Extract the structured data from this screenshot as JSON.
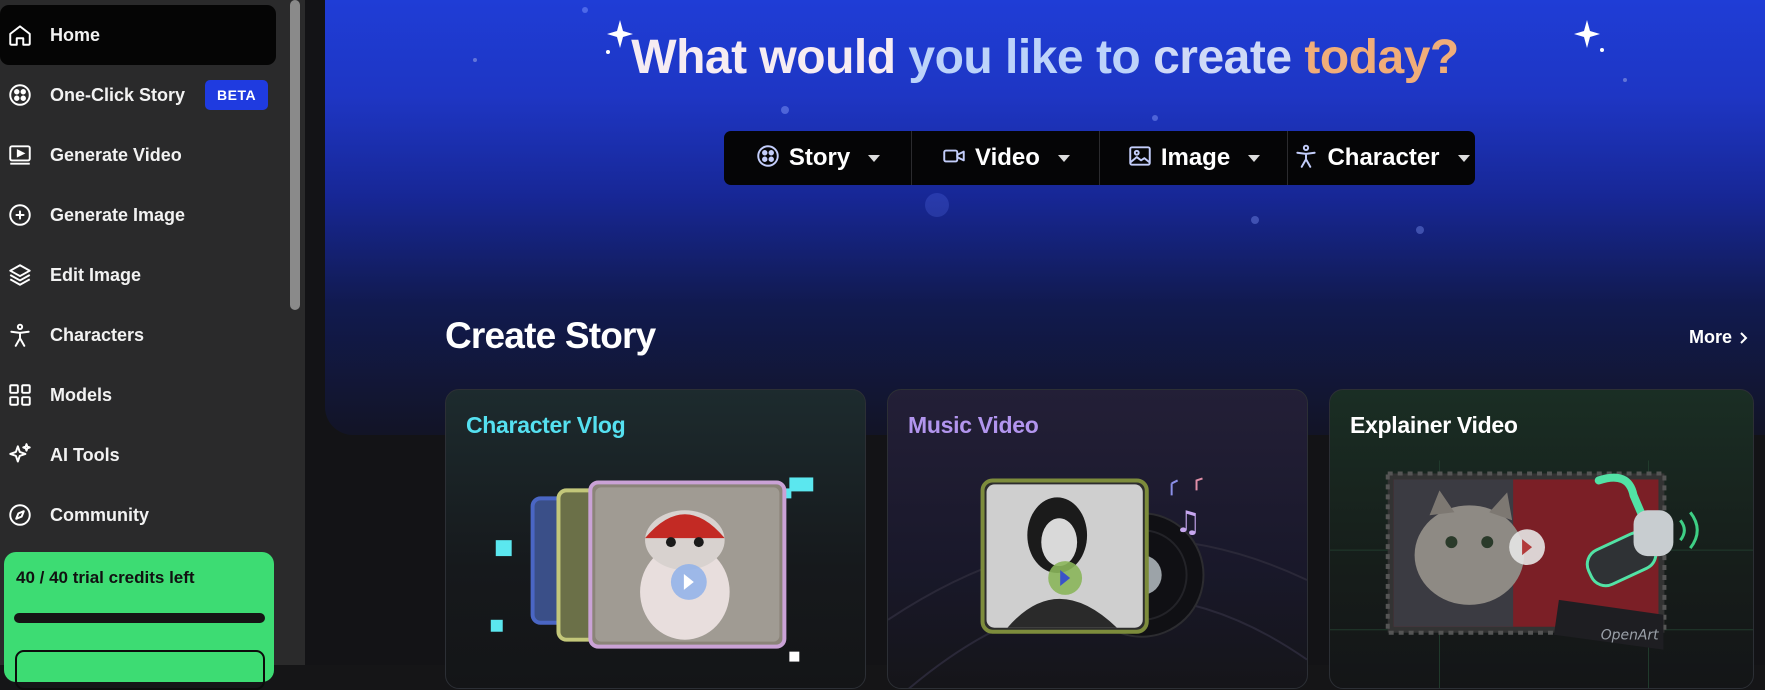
{
  "sidebar": {
    "items": [
      {
        "label": "Home",
        "icon": "home-icon",
        "active": true
      },
      {
        "label": "One-Click Story",
        "icon": "film-reel-icon",
        "badge": "BETA"
      },
      {
        "label": "Generate Video",
        "icon": "video-play-icon"
      },
      {
        "label": "Generate Image",
        "icon": "plus-circle-icon"
      },
      {
        "label": "Edit Image",
        "icon": "layers-icon"
      },
      {
        "label": "Characters",
        "icon": "person-icon"
      },
      {
        "label": "Models",
        "icon": "grid-icon"
      },
      {
        "label": "AI Tools",
        "icon": "sparkles-icon"
      },
      {
        "label": "Community",
        "icon": "compass-icon"
      }
    ],
    "credits": {
      "text": "40 / 40 trial credits left",
      "used": 40,
      "total": 40
    }
  },
  "hero": {
    "title_part1": "What would you like to create",
    "title_part2": " today?",
    "title_a": "What would ",
    "title_b": "you like to ",
    "title_c": "create ",
    "title_d": "today?",
    "create_options": [
      {
        "label": "Story",
        "icon": "film-reel-icon"
      },
      {
        "label": "Video",
        "icon": "video-camera-icon"
      },
      {
        "label": "Image",
        "icon": "image-icon"
      },
      {
        "label": "Character",
        "icon": "person-icon"
      }
    ]
  },
  "section": {
    "title": "Create Story",
    "more_label": "More"
  },
  "cards": [
    {
      "title": "Character Vlog"
    },
    {
      "title": "Music Video"
    },
    {
      "title": "Explainer Video",
      "overlay_text": "OpenArt"
    }
  ],
  "colors": {
    "accent_green": "#3ddc73",
    "beta_blue": "#1f3be0",
    "card1_title": "#55e0f0",
    "card2_title": "#b295ee",
    "title_peach": "#f0ad79"
  }
}
